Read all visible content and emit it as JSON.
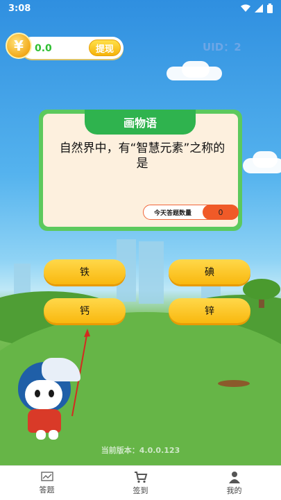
{
  "status_bar": {
    "time": "3:08"
  },
  "header": {
    "coin_symbol": "¥",
    "coin_value": "0.0",
    "withdraw_label": "提现",
    "uid_label": "UID：2"
  },
  "question_card": {
    "title": "画物语",
    "question": "自然界中，有“智慧元素”之称的是",
    "count_label": "今天答题数量",
    "count_value": "0"
  },
  "answers": [
    {
      "label": "铁"
    },
    {
      "label": "碘"
    },
    {
      "label": "钙"
    },
    {
      "label": "锌"
    }
  ],
  "version_text": "当前版本：4.0.0.123",
  "bottom_nav": [
    {
      "label": "答题",
      "icon": "chart-icon"
    },
    {
      "label": "签到",
      "icon": "cart-icon"
    },
    {
      "label": "我的",
      "icon": "user-icon"
    }
  ],
  "colors": {
    "accent_green": "#2fb34e",
    "answer_yellow": "#f9b80f",
    "count_orange": "#f05a28"
  }
}
